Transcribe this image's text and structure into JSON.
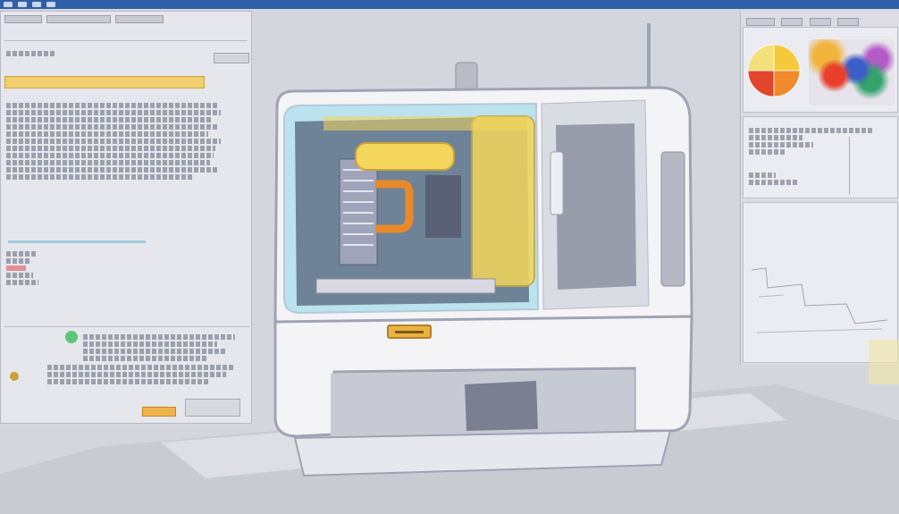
{
  "colors": {
    "background": "#d4d6dd",
    "titlebar": "#2f5fa8",
    "accent_yellow": "#f1cf6e",
    "accent_orange": "#e08a2c",
    "machine_body": "#f4f3f6",
    "machine_outline": "#9fa3b4"
  },
  "icons": [
    "window-toolbar-icon",
    "pie-chart-icon",
    "heatmap-icon",
    "label-plate-icon"
  ],
  "pie_chart": {
    "slice_colors": [
      "#f6c93a",
      "#f08a2a",
      "#e2452d",
      "#f3e07a"
    ]
  }
}
